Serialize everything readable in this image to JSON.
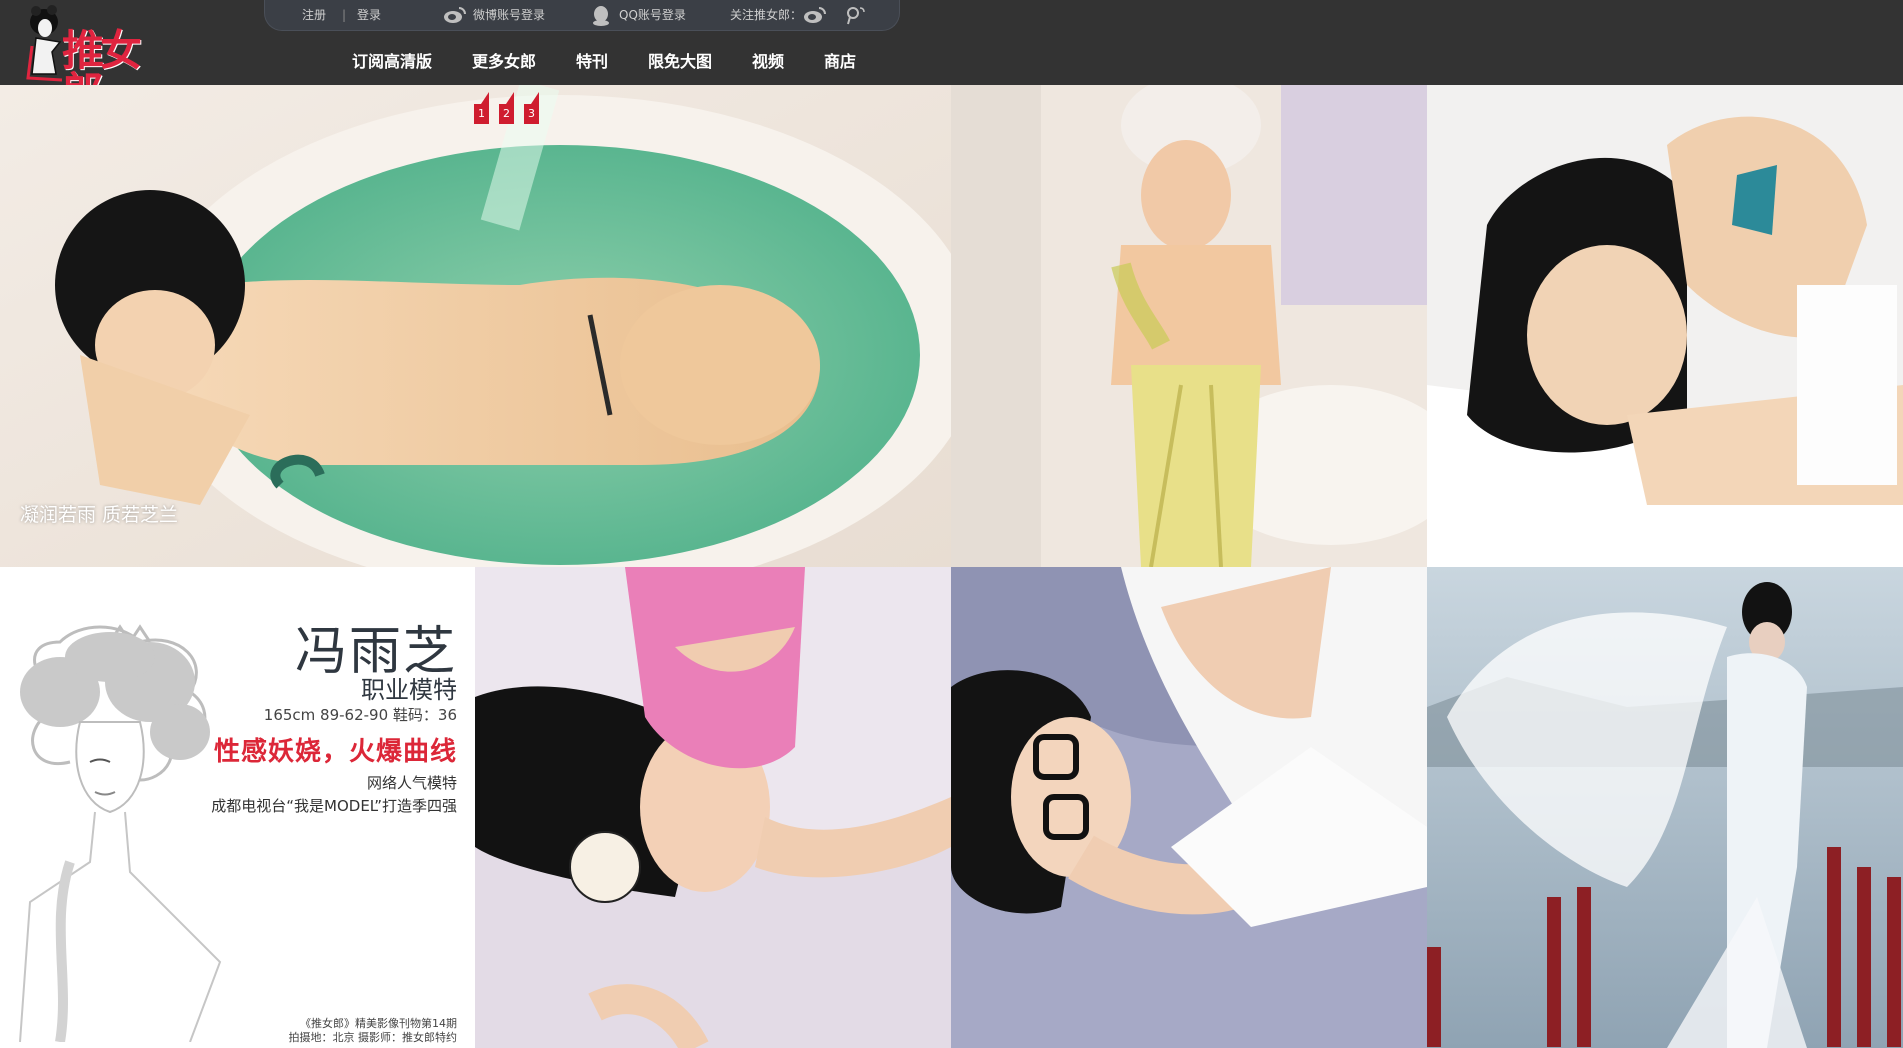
{
  "brand": {
    "logo_text": "推女郎"
  },
  "account": {
    "register": "注册",
    "separator": "|",
    "login": "登录",
    "weibo_login": "微博账号登录",
    "qq_login": "QQ账号登录",
    "follow": "关注推女郎：",
    "icons": [
      "weibo-icon",
      "qq-penguin-icon",
      "weibo-icon",
      "tencent-weibo-icon"
    ]
  },
  "nav": {
    "items": [
      "订阅高清版",
      "更多女郎",
      "特刊",
      "限免大图",
      "视频",
      "商店"
    ]
  },
  "slider": {
    "indicators": [
      "1",
      "2",
      "3"
    ],
    "caption": "凝润若雨 质若芝兰"
  },
  "profile": {
    "name": "冯雨芝",
    "occupation": "职业模特",
    "stats": "165cm 89-62-90 鞋码：36",
    "tagline": "性感妖娆，火爆曲线",
    "desc_line1": "网络人气模特",
    "desc_line2": "成都电视台“我是MODEL”打造季四强",
    "credit_line1": "《推女郎》精美影像刊物第14期",
    "credit_line2": "拍摄地：北京 摄影师：推女郎特约"
  },
  "colors": {
    "topbar": "#333333",
    "accent_red": "#dc2738",
    "indicator_red": "#cf1d2f"
  }
}
